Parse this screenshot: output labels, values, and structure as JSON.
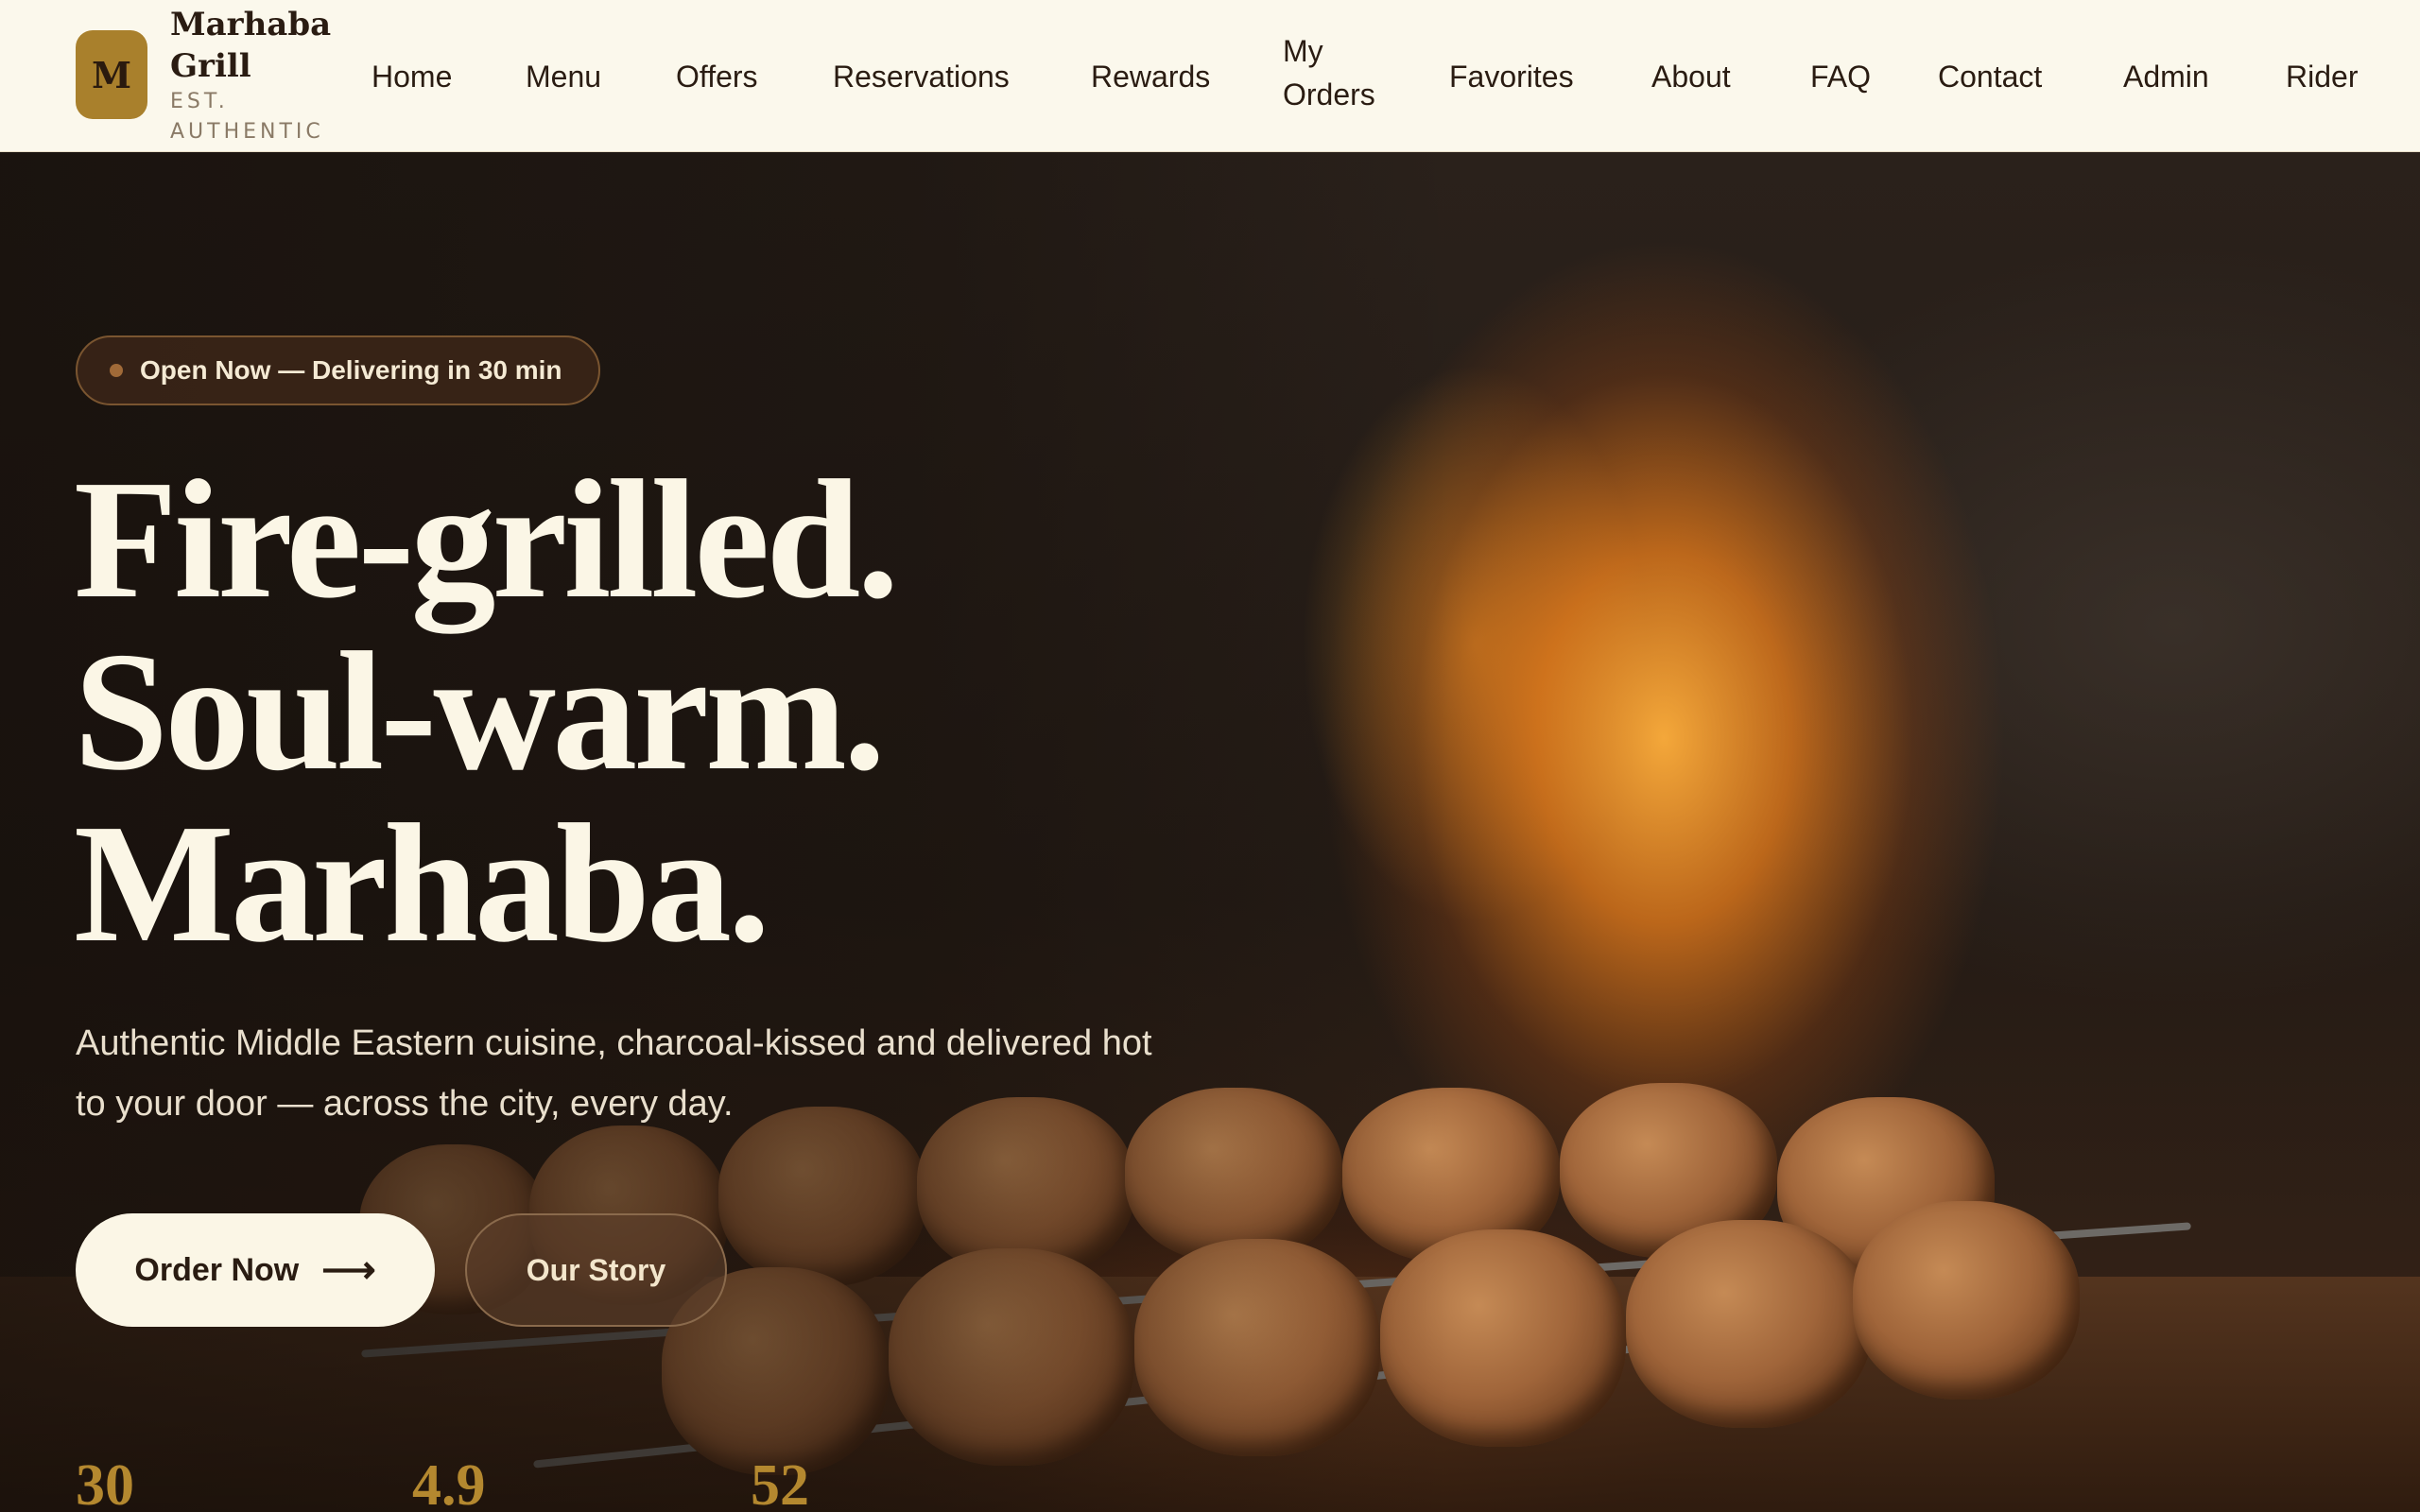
{
  "brand": {
    "logo_letter": "M",
    "name": "Marhaba Grill",
    "tagline": "EST. AUTHENTIC",
    "accent": "#a9802c"
  },
  "nav": {
    "items": [
      {
        "label": "Home"
      },
      {
        "label": "Menu"
      },
      {
        "label": "Offers"
      },
      {
        "label": "Reservations"
      },
      {
        "label": "Rewards"
      },
      {
        "label": "My Orders"
      },
      {
        "label": "Favorites"
      },
      {
        "label": "About"
      },
      {
        "label": "FAQ"
      },
      {
        "label": "Contact"
      },
      {
        "label": "Admin"
      },
      {
        "label": "Rider"
      }
    ]
  },
  "hero": {
    "status": "Open Now — Delivering in 30 min",
    "headline_lines": [
      "Fire-grilled.",
      "Soul-warm.",
      "Marhaba."
    ],
    "subcopy": "Authentic Middle Eastern cuisine, charcoal-kissed and delivered hot to your door — across the city, every day.",
    "primary_cta": "Order Now",
    "primary_cta_icon": "arrow-right-icon",
    "secondary_cta": "Our Story"
  },
  "stats": [
    {
      "value": "30"
    },
    {
      "value": "4.9"
    },
    {
      "value": "52"
    }
  ],
  "colors": {
    "header_bg": "#fbf8ec",
    "hero_text": "#fbf6e6",
    "stat_gold": "#b4882f"
  }
}
